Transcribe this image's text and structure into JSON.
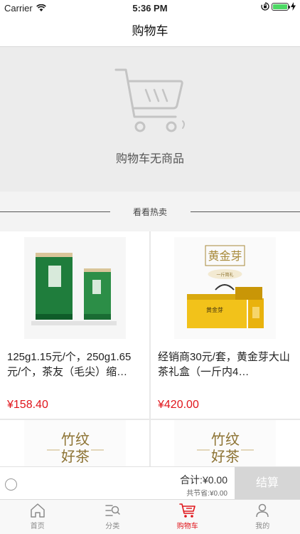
{
  "status_bar": {
    "carrier": "Carrier",
    "time": "5:36 PM",
    "colors": {
      "battery": "#4cd964"
    }
  },
  "header": {
    "title": "购物车"
  },
  "empty_cart": {
    "message": "购物车无商品",
    "icon": "shopping-cart-icon"
  },
  "hot_section": {
    "label": "看看热卖"
  },
  "products": [
    {
      "title": "125g1.15元/个，250g1.65元/个，茶友（毛尖）缩…",
      "price": "¥158.40"
    },
    {
      "title": "经销商30元/套，黄金芽大山茶礼盒（一斤内4…",
      "price": "¥420.00",
      "image_text": [
        "黄金芽",
        "一斤简礼",
        "黄金芽"
      ]
    },
    {
      "title": "",
      "price": "",
      "image_text": [
        "竹纹",
        "好茶"
      ]
    },
    {
      "title": "",
      "price": "",
      "image_text": [
        "竹纹",
        "好茶"
      ]
    }
  ],
  "checkout_bar": {
    "total": "合计:¥0.00",
    "saved": "共节省:¥0.00",
    "checkout_label": "结算"
  },
  "tabs": [
    {
      "label": "首页",
      "icon": "home-icon",
      "active": false
    },
    {
      "label": "分类",
      "icon": "category-icon",
      "active": false
    },
    {
      "label": "购物车",
      "icon": "cart-icon",
      "active": true
    },
    {
      "label": "我的",
      "icon": "profile-icon",
      "active": false
    }
  ],
  "colors": {
    "accent": "#e0151b",
    "checkout_button": "#d6d6d6"
  }
}
